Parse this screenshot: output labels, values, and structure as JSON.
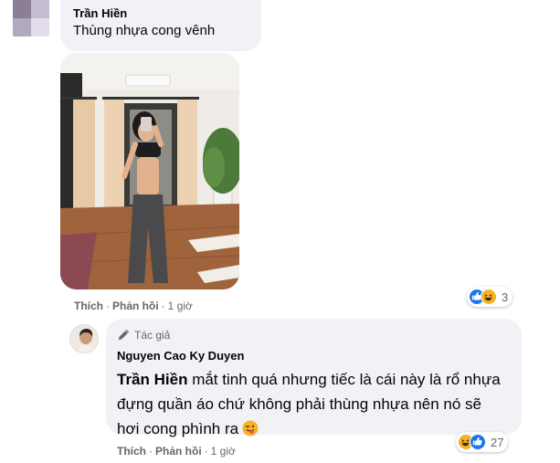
{
  "top_comment": {
    "author": "Trần Hiền",
    "text": "Thùng nhựa cong vênh",
    "actions": {
      "like": "Thích",
      "reply": "Phản hồi",
      "separator": "·",
      "time": "1 giờ"
    },
    "reactions": {
      "icons": [
        "like-icon",
        "haha-icon"
      ],
      "count": "3"
    }
  },
  "reply": {
    "badge": "Tác giả",
    "author": "Nguyen Cao Ky Duyen",
    "mention": "Trần Hiền",
    "text": " mắt tinh quá nhưng tiếc là cái này là rổ nhựa đựng quần áo chứ không phải thùng nhựa nên nó sẽ hơi cong phình ra",
    "actions": {
      "like": "Thích",
      "reply": "Phản hồi",
      "separator": "·",
      "time": "1 giờ"
    },
    "reactions": {
      "icons": [
        "haha-icon",
        "like-icon"
      ],
      "count": "27"
    }
  }
}
